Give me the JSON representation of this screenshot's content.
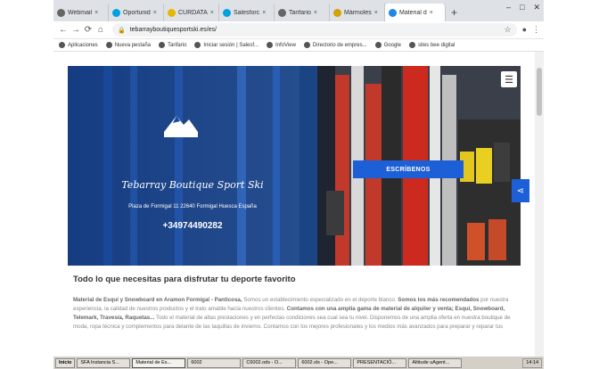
{
  "tabs": [
    {
      "label": "Webmail",
      "icon": "globe-icon",
      "color": "#666666"
    },
    {
      "label": "Oportunid",
      "icon": "cloud-icon",
      "color": "#00a1e0"
    },
    {
      "label": "CURDATA",
      "icon": "cd-icon",
      "color": "#e8b600"
    },
    {
      "label": "Salesforc",
      "icon": "cloud-icon",
      "color": "#00a1e0"
    },
    {
      "label": "Tarifario",
      "icon": "globe-icon",
      "color": "#666666"
    },
    {
      "label": "Mármoles",
      "icon": "mm-icon",
      "color": "#d4a100"
    },
    {
      "label": "Material d",
      "icon": "diamond-icon",
      "color": "#1e88e5",
      "active": true
    }
  ],
  "new_tab": "+",
  "address": {
    "url": "tebarrayboutiquesportski.es/es/"
  },
  "bookmarks": [
    {
      "label": "Aplicaciones"
    },
    {
      "label": "Nueva pestaña"
    },
    {
      "label": "Tarifario"
    },
    {
      "label": "Iniciar sesión | Salesf..."
    },
    {
      "label": "InfoView"
    },
    {
      "label": "Directorio de empres..."
    },
    {
      "label": "Google"
    },
    {
      "label": "sites bee digital"
    }
  ],
  "hero": {
    "brand": "Tebarray Boutique Sport Ski",
    "address": "Plaza de Formigal 11 22640 Formigal Huesca España",
    "phone": "+34974490282",
    "cta": "ESCRÍBENOS",
    "logo_text": "Tebarray"
  },
  "section": {
    "title": "Todo lo que necesitas para disfrutar tu deporte favorito",
    "p1_bold": "Material de Esquí y Snowboard en Aramon Formigal - Panticosa,",
    "p1_text": " Somos un establecimiento especializado en el deporte blanco. ",
    "p1_bold2": "Somos los más recomendados",
    "p1_text2": " por nuestra experiencia, la calidad de nuestros productos y el trato amable hacia nuestros clientes. ",
    "p1_bold3": "Contamos con una amplia gama de material de alquiler y venta; Esquí, Snowboard, Telemark, Travesía, Raquetas...",
    "p1_text3": " Todo el material de altas prestaciones y en perfectas condiciones sea cual sea tu nivel. Disponemos de una amplia oferta en nuestra boutique de moda, ropa técnica y complementos para",
    "p1_text4": " delante de las taquillas de invierno. Contamos con los mejores profesionales y los medios más avanzados para preparar y reparar tus"
  },
  "taskbar": {
    "start": "Inicio",
    "items": [
      {
        "label": "SFA Instancia S..."
      },
      {
        "label": "Material de Es...",
        "active": true
      },
      {
        "label": "6002"
      },
      {
        "label": "C6002.ods - O..."
      },
      {
        "label": "6002.xls - Ope..."
      },
      {
        "label": "PRESENTACIÓ..."
      },
      {
        "label": "Altitude uAgent..."
      }
    ],
    "clock": "14:14"
  }
}
